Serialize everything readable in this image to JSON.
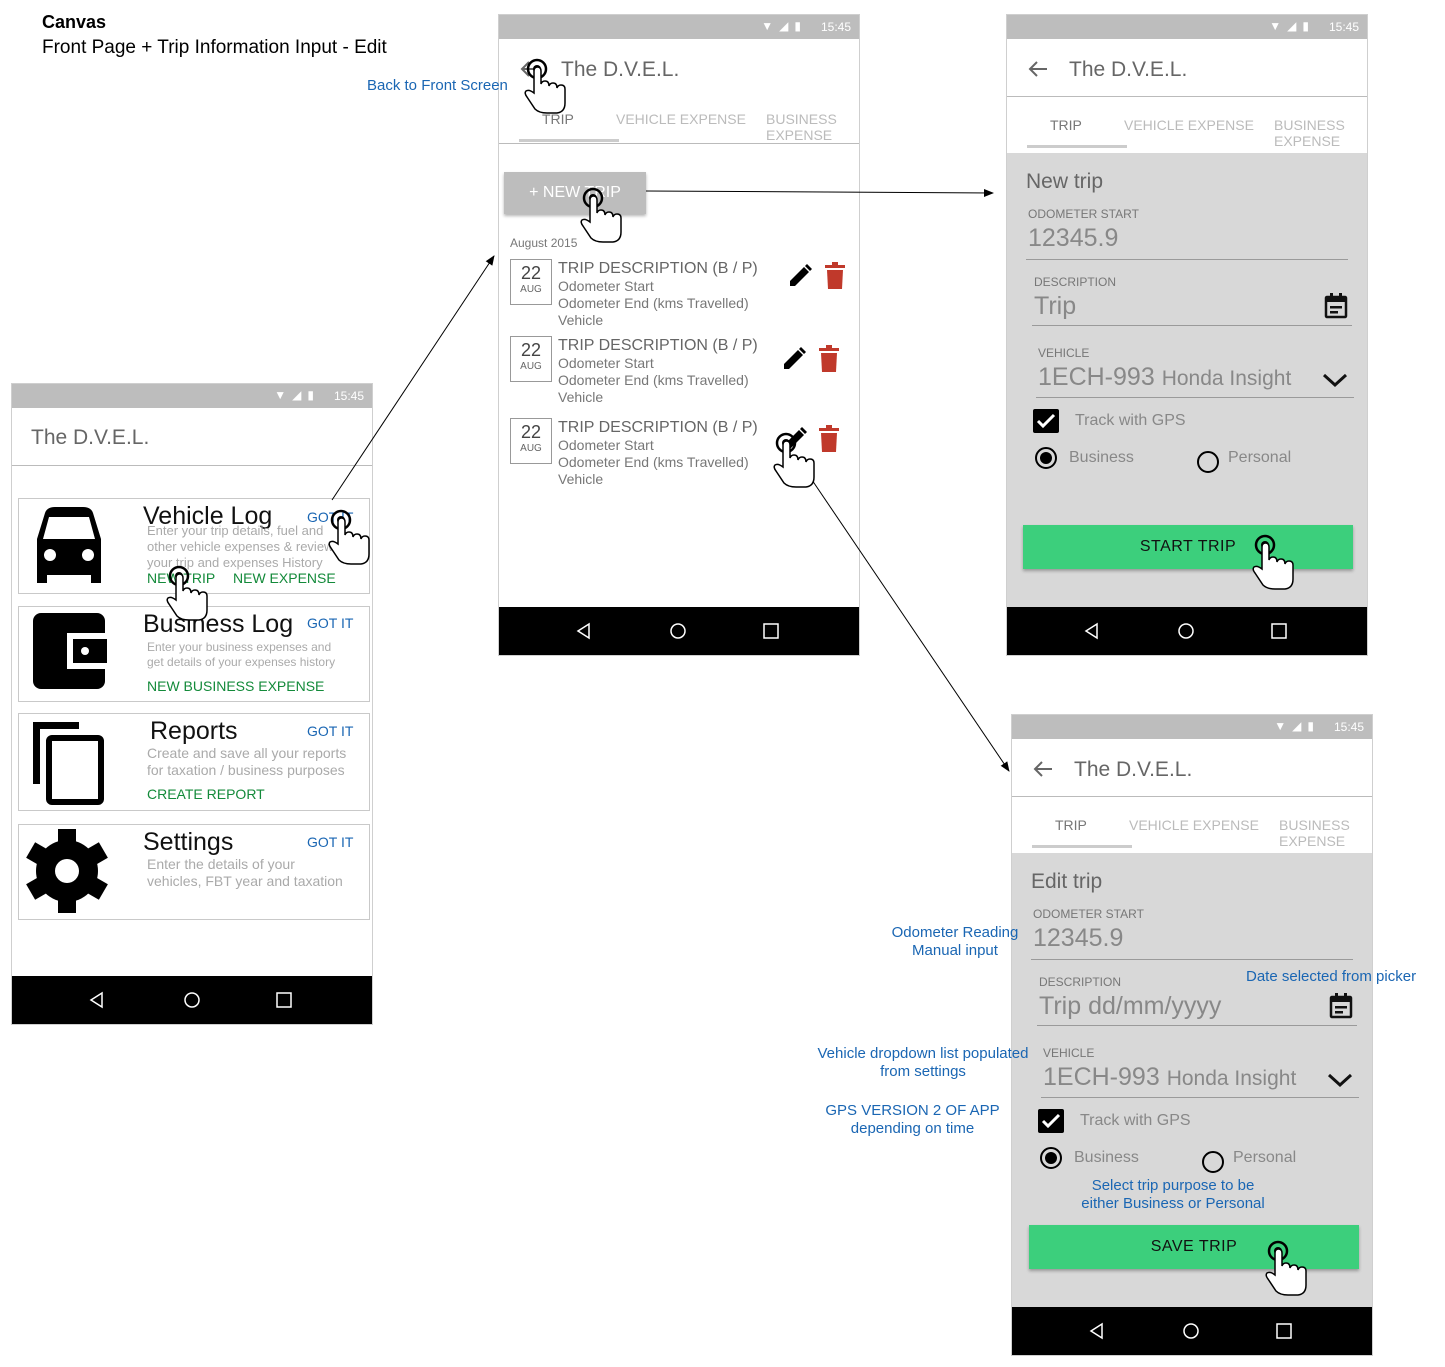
{
  "canvas": {
    "title": "Canvas",
    "subtitle": "Front Page + Trip Information Input - Edit"
  },
  "status_time": "15:45",
  "app_title": "The D.V.E.L.",
  "front_page": {
    "cards": [
      {
        "title": "Vehicle Log",
        "got_it": "GOT IT",
        "desc": [
          "Enter your trip details, fuel and",
          "other vehicle expenses & review",
          "your trip and expenses History"
        ],
        "actions": [
          "NEW TRIP",
          "NEW EXPENSE"
        ],
        "icon": "car-icon"
      },
      {
        "title": "Business Log",
        "got_it": "GOT IT",
        "desc": [
          "Enter your business expenses and",
          "get details of your expenses history"
        ],
        "actions": [
          "NEW BUSINESS EXPENSE"
        ],
        "icon": "wallet-icon"
      },
      {
        "title": "Reports",
        "got_it": "GOT IT",
        "desc": [
          "Create and save all your reports",
          "for taxation / business purposes"
        ],
        "actions": [
          "CREATE REPORT"
        ],
        "icon": "copy-icon"
      },
      {
        "title": "Settings",
        "got_it": "GOT IT",
        "desc": [
          "Enter the details of your",
          "vehicles, FBT year and taxation"
        ],
        "actions": [],
        "icon": "gear-icon"
      }
    ]
  },
  "tabs": [
    "TRIP",
    "VEHICLE EXPENSE",
    "BUSINESS EXPENSE"
  ],
  "trip_list": {
    "new_trip_label": "+ NEW TRIP",
    "month": "August 2015",
    "items": [
      {
        "day": "22",
        "month": "AUG",
        "title": "TRIP DESCRIPTION  (B / P)",
        "lines": [
          "Odometer Start",
          "Odometer End (kms Travelled)",
          "Vehicle"
        ]
      },
      {
        "day": "22",
        "month": "AUG",
        "title": "TRIP DESCRIPTION  (B / P)",
        "lines": [
          "Odometer Start",
          "Odometer End (kms Travelled)",
          "Vehicle"
        ]
      },
      {
        "day": "22",
        "month": "AUG",
        "title": "TRIP DESCRIPTION  (B / P)",
        "lines": [
          "Odometer Start",
          "Odometer End (kms Travelled)",
          "Vehicle"
        ]
      }
    ]
  },
  "new_trip_form": {
    "heading": "New trip",
    "odometer_label": "ODOMETER START",
    "odometer_value": "12345.9",
    "description_label": "DESCRIPTION",
    "description_value": "Trip",
    "vehicle_label": "VEHICLE",
    "vehicle_plate": "1ECH-993",
    "vehicle_name": "Honda Insight",
    "gps_label": "Track with GPS",
    "gps_checked": true,
    "purpose_options": [
      "Business",
      "Personal"
    ],
    "purpose_selected": "Business",
    "button": "START TRIP"
  },
  "edit_trip_form": {
    "heading": "Edit trip",
    "odometer_label": "ODOMETER START",
    "odometer_value": "12345.9",
    "description_label": "DESCRIPTION",
    "description_value": "Trip dd/mm/yyyy",
    "vehicle_label": "VEHICLE",
    "vehicle_plate": "1ECH-993",
    "vehicle_name": "Honda Insight",
    "gps_label": "Track with GPS",
    "gps_checked": true,
    "purpose_options": [
      "Business",
      "Personal"
    ],
    "purpose_selected": "Business",
    "button": "SAVE TRIP"
  },
  "annotations": {
    "back_to_front": "Back to Front Screen",
    "odometer_note": [
      "Odometer Reading",
      "Manual input"
    ],
    "date_note": "Date selected from picker",
    "vehicle_note": [
      "Vehicle dropdown list populated",
      "from settings"
    ],
    "gps_note": [
      "GPS VERSION 2 OF APP",
      "depending on time"
    ],
    "purpose_note": [
      "Select trip purpose to be",
      "either Business or Personal"
    ]
  },
  "colors": {
    "link_blue": "#1a66b3",
    "action_green": "#138a3a",
    "button_green": "#3ccf7c",
    "delete_red": "#c0392b",
    "status_grey": "#bdbdbd"
  }
}
